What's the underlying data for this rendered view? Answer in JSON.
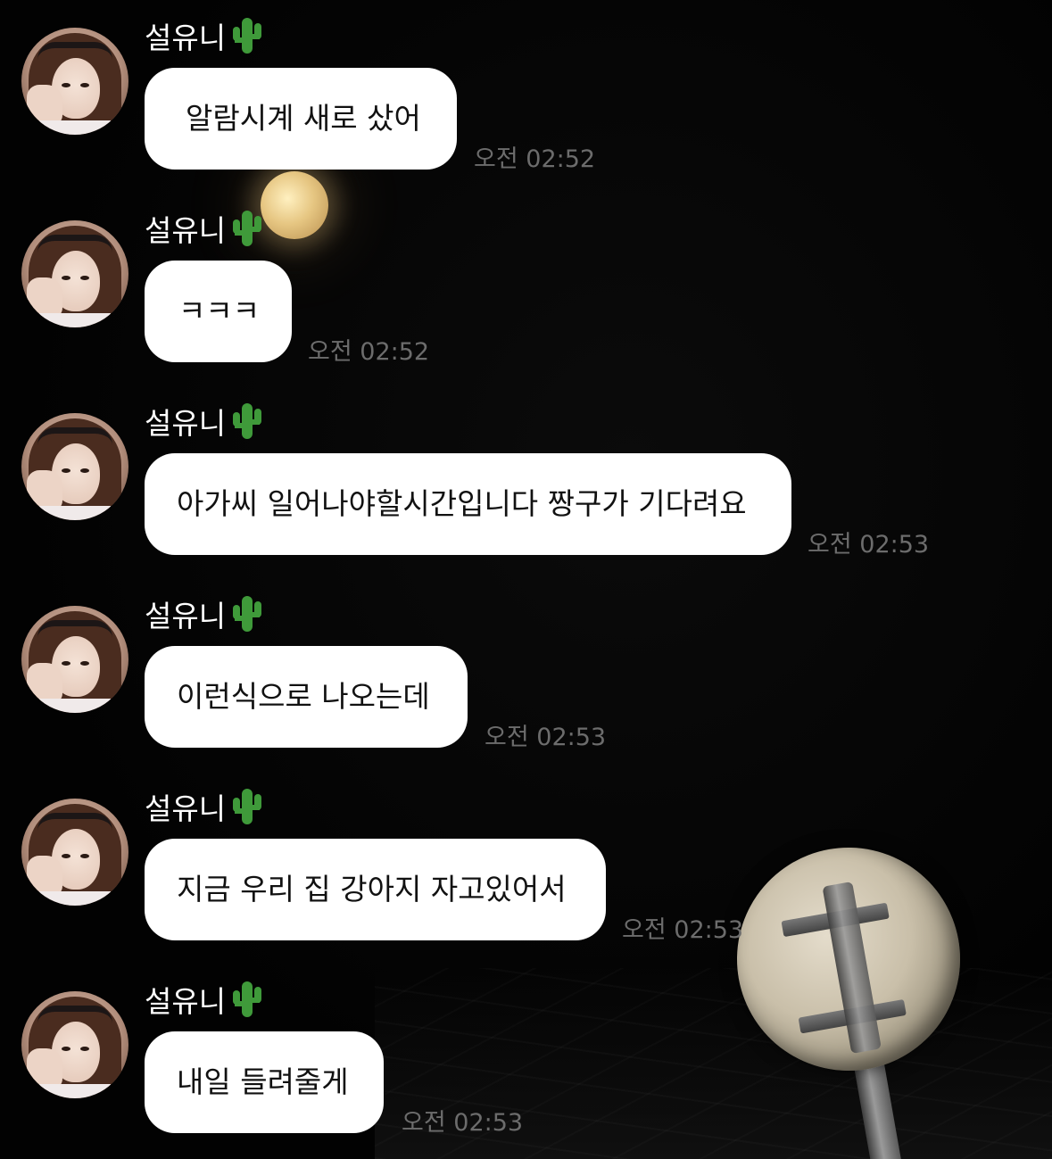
{
  "messages": [
    {
      "sender": "설유니",
      "text": "알람시계 새로 샀어",
      "time": "오전 02:52"
    },
    {
      "sender": "설유니",
      "text": "ㅋㅋㅋ",
      "time": "오전 02:52"
    },
    {
      "sender": "설유니",
      "text": "아가씨 일어나야할시간입니다 짱구가 기다려요",
      "time": "오전 02:53"
    },
    {
      "sender": "설유니",
      "text": "이런식으로 나오는데",
      "time": "오전 02:53"
    },
    {
      "sender": "설유니",
      "text": "지금 우리 집 강아지 자고있어서",
      "time": "오전 02:53"
    },
    {
      "sender": "설유니",
      "text": "내일 들려줄게",
      "time": "오전 02:53"
    }
  ],
  "icons": {
    "sender_emoji": "cactus-icon"
  },
  "colors": {
    "background": "#000000",
    "bubble": "#ffffff",
    "timestamp": "#6c6c6c",
    "sender_name": "#ffffff"
  }
}
